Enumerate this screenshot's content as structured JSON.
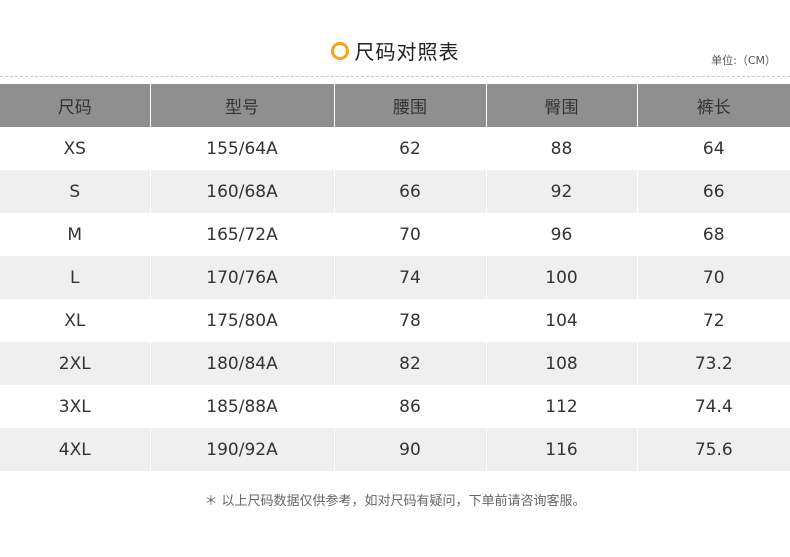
{
  "title": "尺码对照表",
  "unit": "单位:（CM）",
  "headers": [
    "尺码",
    "型号",
    "腰围",
    "臀围",
    "裤长"
  ],
  "rows": [
    [
      "XS",
      "155/64A",
      "62",
      "88",
      "64"
    ],
    [
      "S",
      "160/68A",
      "66",
      "92",
      "66"
    ],
    [
      "M",
      "165/72A",
      "70",
      "96",
      "68"
    ],
    [
      "L",
      "170/76A",
      "74",
      "100",
      "70"
    ],
    [
      "XL",
      "175/80A",
      "78",
      "104",
      "72"
    ],
    [
      "2XL",
      "180/84A",
      "82",
      "108",
      "73.2"
    ],
    [
      "3XL",
      "185/88A",
      "86",
      "112",
      "74.4"
    ],
    [
      "4XL",
      "190/92A",
      "90",
      "116",
      "75.6"
    ]
  ],
  "note": "＊ 以上尺码数据仅供参考，如对尺码有疑问，下单前请咨询客服。",
  "colors": {
    "accent": "#f5a31a",
    "header_bg": "#8f8f8f",
    "stripe_bg": "#efefef"
  },
  "icons": {
    "title_icon": "ring-icon"
  }
}
